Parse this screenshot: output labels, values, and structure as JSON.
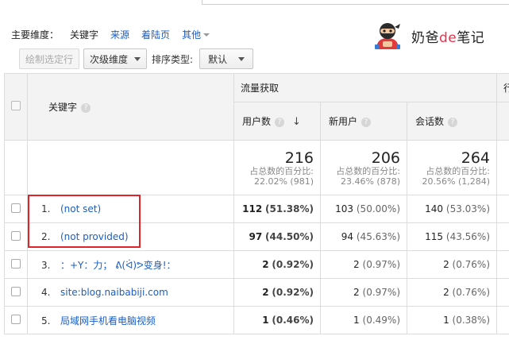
{
  "primary_dimension": {
    "label": "主要维度：",
    "active": "关键字",
    "links": [
      "来源",
      "着陆页"
    ],
    "more": "其他"
  },
  "watermark": {
    "pre": "奶爸",
    "de": "de",
    "post": "笔记"
  },
  "toolbar": {
    "plot_rows": "绘制选定行",
    "secondary_dim": "次级维度",
    "sort_label": "排序类型:",
    "sort_value": "默认"
  },
  "table": {
    "group_acquisition": "流量获取",
    "group_behavior": "行",
    "col_keyword": "关键字",
    "col_users": "用户数",
    "col_new_users": "新用户",
    "col_sessions": "会话数",
    "totals": {
      "users": {
        "value": "216",
        "pct_label": "占总数的百分比:",
        "pct": "22.02% (981)"
      },
      "new_users": {
        "value": "206",
        "pct_label": "占总数的百分比:",
        "pct": "23.46% (878)"
      },
      "sessions": {
        "value": "264",
        "pct_label": "占总数的百分比:",
        "pct": "20.56% (1,284)"
      }
    },
    "rows": [
      {
        "num": "1.",
        "keyword": "(not set)",
        "users": "112",
        "users_pct": "(51.38%)",
        "new_users": "103",
        "new_users_pct": "(50.00%)",
        "sessions": "140",
        "sessions_pct": "(53.03%)"
      },
      {
        "num": "2.",
        "keyword": "(not provided)",
        "users": "97",
        "users_pct": "(44.50%)",
        "new_users": "94",
        "new_users_pct": "(45.63%)",
        "sessions": "115",
        "sessions_pct": "(43.56%)"
      },
      {
        "num": "3.",
        "keyword": "：+Y：力；  ᕕ(ᐛ)ᕗ变身!：",
        "users": "2",
        "users_pct": "(0.92%)",
        "new_users": "2",
        "new_users_pct": "(0.97%)",
        "sessions": "2",
        "sessions_pct": "(0.76%)"
      },
      {
        "num": "4.",
        "keyword": "site:blog.naibabiji.com",
        "users": "2",
        "users_pct": "(0.92%)",
        "new_users": "2",
        "new_users_pct": "(0.97%)",
        "sessions": "2",
        "sessions_pct": "(0.76%)"
      },
      {
        "num": "5.",
        "keyword": "局域网手机看电脑视频",
        "users": "1",
        "users_pct": "(0.46%)",
        "new_users": "1",
        "new_users_pct": "(0.49%)",
        "sessions": "1",
        "sessions_pct": "(0.38%)"
      }
    ]
  },
  "colors": {
    "link": "#1a5ec6",
    "highlight": "#e0242a",
    "header_bg": "#f3f3f3"
  }
}
